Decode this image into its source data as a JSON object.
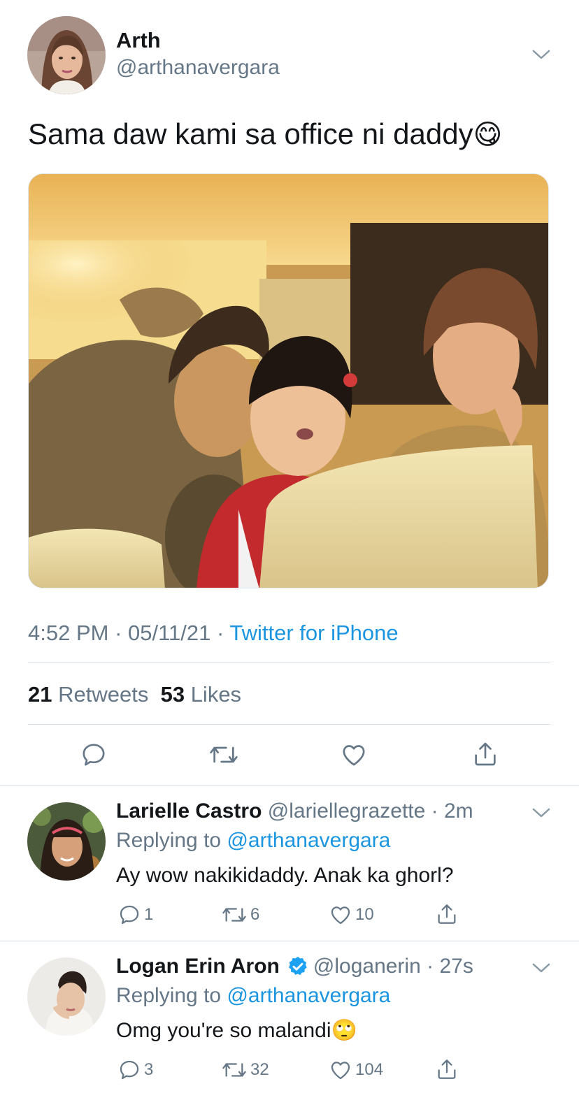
{
  "tweet": {
    "author": {
      "display_name": "Arth",
      "handle": "@arthanavergara",
      "avatar_icon": "profile-photo"
    },
    "text": "Sama daw kami sa office ni daddy",
    "text_emoji": "😋",
    "emoji_icon": "yum-face-emoji",
    "photo": {
      "description_icon": "car-interior-photo"
    },
    "time": "4:52 PM",
    "date": "05/11/21",
    "source": "Twitter for iPhone",
    "retweets_count": "21",
    "retweets_label": "Retweets",
    "likes_count": "53",
    "likes_label": "Likes",
    "actions": [
      "reply-icon",
      "retweet-icon",
      "like-icon",
      "share-icon"
    ]
  },
  "replies": [
    {
      "display_name": "Larielle Castro",
      "verified": false,
      "handle": "@lariellegrazette",
      "time": "2m",
      "replying_to_label": "Replying to",
      "replying_to_handle": "@arthanavergara",
      "text": "Ay wow nakikidaddy. Anak ka ghorl?",
      "reply_count": "1",
      "retweet_count": "6",
      "like_count": "10"
    },
    {
      "display_name": "Logan Erin Aron",
      "verified": true,
      "handle": "@loganerin",
      "time": "27s",
      "replying_to_label": "Replying to",
      "replying_to_handle": "@arthanavergara",
      "text": "Omg you're so malandi",
      "text_emoji": "🙄",
      "emoji_icon": "eye-roll-emoji",
      "reply_count": "3",
      "retweet_count": "32",
      "like_count": "104"
    }
  ],
  "colors": {
    "link": "#1b95e0",
    "muted": "#657786",
    "divider": "#d7dee3",
    "verified": "#1da1f2",
    "text": "#14171a"
  }
}
